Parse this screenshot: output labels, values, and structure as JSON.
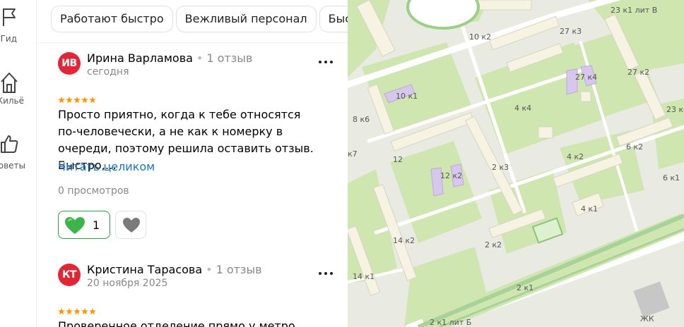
{
  "nav": {
    "items": [
      {
        "label": "Гид",
        "icon": "flag-icon"
      },
      {
        "label": "Жильё",
        "icon": "house-icon"
      },
      {
        "label": "Советы",
        "icon": "thumb-up-icon"
      }
    ]
  },
  "filters": {
    "chips": [
      "Работают быстро",
      "Вежливый персонал",
      "Быстр"
    ]
  },
  "reviews": [
    {
      "initials": "ИВ",
      "author": "Ирина Варламова",
      "separator": "•",
      "review_count": "1 отзыв",
      "date": "сегодня",
      "rating": 5,
      "text": "Просто приятно, когда к тебе относятся по-человечески, а не как к номерку в очереди, поэтому решила оставить отзыв. Быстро,…",
      "read_more": "Читать целиком",
      "views": "0 просмотров",
      "likes": "1"
    },
    {
      "initials": "КТ",
      "author": "Кристина Тарасова",
      "separator": "•",
      "review_count": "1 отзыв",
      "date": "20 ноября 2025",
      "rating": 5,
      "text": "Проверенное отделение прямо у метро"
    }
  ],
  "colors": {
    "avatar": "#e32636",
    "star": "#ff9500",
    "link": "#1a73c8",
    "like_border": "#2f9e44",
    "map_green": "#cfe6b1",
    "map_building": "#f7f3e3",
    "map_highlight": "#d7c7ec"
  },
  "map": {
    "labels": [
      "23 к1 лит В",
      "10 к2",
      "27 к3",
      "27 к4",
      "27 к2",
      "10 к1",
      "4 к4",
      "23 к",
      "8 к6",
      "к7",
      "12",
      "12 к2",
      "2 к3",
      "4 к2",
      "6 к2",
      "6 к1",
      "4 к1",
      "14 к2",
      "2 к2",
      "14 к1",
      "2 к1",
      "2 к1 лит Б",
      "ЖК"
    ]
  }
}
